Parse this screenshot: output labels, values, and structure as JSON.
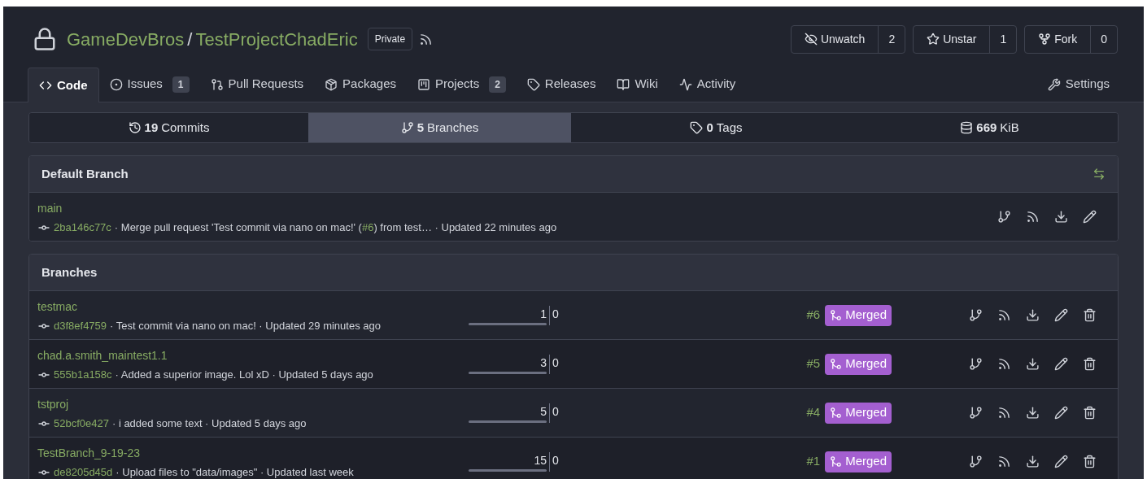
{
  "repo": {
    "owner": "GameDevBros",
    "separator": "/",
    "name": "TestProjectChadEric",
    "visibility": "Private"
  },
  "actions": [
    {
      "kind": "watch",
      "label": "Unwatch",
      "count": "2"
    },
    {
      "kind": "star",
      "label": "Unstar",
      "count": "1"
    },
    {
      "kind": "fork",
      "label": "Fork",
      "count": "0"
    }
  ],
  "tabs": [
    {
      "kind": "code",
      "label": "Code",
      "selected": true
    },
    {
      "kind": "issues",
      "label": "Issues",
      "count": "1",
      "selected": false
    },
    {
      "kind": "pulls",
      "label": "Pull Requests",
      "selected": false
    },
    {
      "kind": "packages",
      "label": "Packages",
      "selected": false
    },
    {
      "kind": "projects",
      "label": "Projects",
      "count": "2",
      "selected": false
    },
    {
      "kind": "releases",
      "label": "Releases",
      "selected": false
    },
    {
      "kind": "wiki",
      "label": "Wiki",
      "selected": false
    },
    {
      "kind": "activity",
      "label": "Activity",
      "selected": false
    }
  ],
  "settings_tab": {
    "label": "Settings"
  },
  "stats": [
    {
      "kind": "commits",
      "count": "19",
      "label": "Commits",
      "selected": false
    },
    {
      "kind": "branches",
      "count": "5",
      "label": "Branches",
      "selected": true
    },
    {
      "kind": "tags",
      "count": "0",
      "label": "Tags",
      "selected": false
    },
    {
      "kind": "size",
      "count": "669",
      "label": "KiB",
      "selected": false
    }
  ],
  "default_branch": {
    "title": "Default Branch",
    "branch": {
      "name": "main",
      "sha": "2ba146c77c",
      "separators": [
        "·",
        "·"
      ],
      "message": "Merge pull request 'Test commit via nano on mac!' (",
      "pr_link": "#6",
      "message_end": ") from test…",
      "updated": "Updated 22 minutes ago"
    }
  },
  "branches": {
    "title": "Branches",
    "rows": [
      {
        "name": "testmac",
        "sha": "d3f8ef4759",
        "separators": [
          "·",
          "·"
        ],
        "message": "Test commit via nano on mac!",
        "updated": "Updated 29 minutes ago",
        "behind": "1",
        "ahead": "0",
        "pr": "#6",
        "status": "Merged"
      },
      {
        "name": "chad.a.smith_maintest1.1",
        "sha": "555b1a158c",
        "separators": [
          "·",
          "·"
        ],
        "message": "Added a superior image. Lol xD",
        "updated": "Updated 5 days ago",
        "behind": "3",
        "ahead": "0",
        "pr": "#5",
        "status": "Merged"
      },
      {
        "name": "tstproj",
        "sha": "52bcf0e427",
        "separators": [
          "·",
          "·"
        ],
        "message": "i added some text",
        "updated": "Updated 5 days ago",
        "behind": "5",
        "ahead": "0",
        "pr": "#4",
        "status": "Merged"
      },
      {
        "name": "TestBranch_9-19-23",
        "sha": "de8205d45d",
        "separators": [
          "·",
          "·"
        ],
        "message": "Upload files to \"data/images\"",
        "updated": "Updated last week",
        "behind": "15",
        "ahead": "0",
        "pr": "#1",
        "status": "Merged"
      }
    ]
  }
}
